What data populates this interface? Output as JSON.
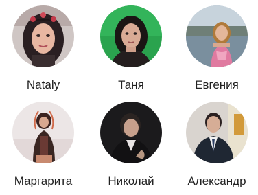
{
  "friends": [
    {
      "name": "Nataly"
    },
    {
      "name": "Таня"
    },
    {
      "name": "Евгения"
    },
    {
      "name": "Маргарита"
    },
    {
      "name": "Николай"
    },
    {
      "name": "Александр"
    }
  ],
  "colors": {
    "text": "#222222",
    "background": "#ffffff"
  }
}
